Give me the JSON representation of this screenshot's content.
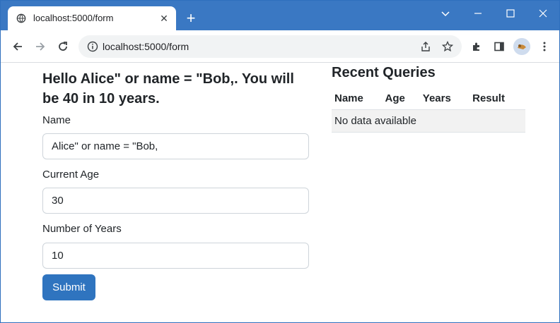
{
  "browser": {
    "tab_title": "localhost:5000/form",
    "tab_close": "✕",
    "new_tab": "+",
    "minimize": "⌄",
    "restore": "–",
    "maximize": "☐",
    "close": "✕",
    "url": "localhost:5000/form"
  },
  "form": {
    "heading": "Hello Alice\" or name = \"Bob,. You will be 40 in 10 years.",
    "name_label": "Name",
    "name_value": "Alice\" or name = \"Bob,",
    "age_label": "Current Age",
    "age_value": "30",
    "years_label": "Number of Years",
    "years_value": "10",
    "submit_label": "Submit"
  },
  "recent": {
    "title": "Recent Queries",
    "columns": [
      "Name",
      "Age",
      "Years",
      "Result"
    ],
    "empty_text": "No data available"
  },
  "colors": {
    "titlebar": "#3a78c3",
    "submit": "#2f74bf"
  }
}
